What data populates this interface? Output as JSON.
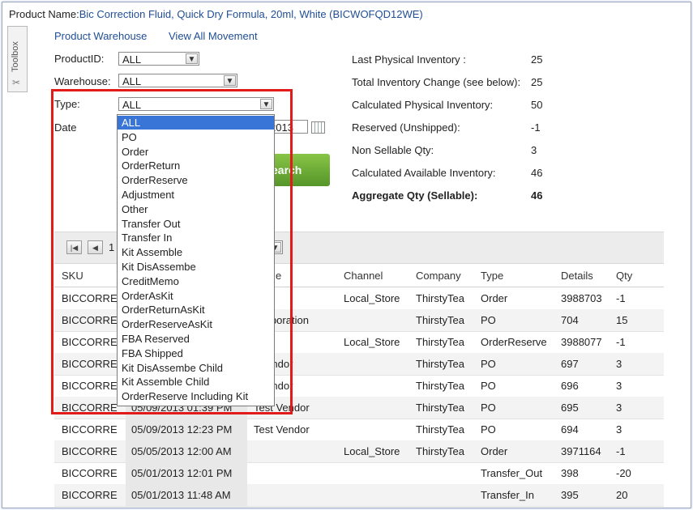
{
  "product": {
    "label": "Product Name:",
    "name": "Bic Correction Fluid, Quick Dry Formula, 20ml, White (BICWOFQD12WE)"
  },
  "toolbox": {
    "label": "Toolbox"
  },
  "links": {
    "warehouse": "Product Warehouse",
    "movement": "View All Movement"
  },
  "filters": {
    "product_id_label": "ProductID:",
    "product_id_value": "ALL",
    "warehouse_label": "Warehouse:",
    "warehouse_value": "ALL",
    "type_label": "Type:",
    "type_value": "ALL",
    "date_label": "Date",
    "date_partial": "2013"
  },
  "search_label": "earch",
  "summary": [
    {
      "label": "Last Physical Inventory :",
      "value": "25"
    },
    {
      "label": "Total Inventory Change (see below):",
      "value": "25"
    },
    {
      "label": "Calculated Physical Inventory:",
      "value": "50"
    },
    {
      "label": "Reserved (Unshipped):",
      "value": "-1"
    },
    {
      "label": "Non Sellable Qty:",
      "value": "3"
    },
    {
      "label": "Calculated Available Inventory:",
      "value": "46"
    },
    {
      "label": "Aggregate Qty (Sellable):",
      "value": "46"
    }
  ],
  "pager": {
    "page_partial": "1"
  },
  "table": {
    "headers": {
      "sku": "SKU",
      "party": "e",
      "channel": "Channel",
      "company": "Company",
      "type": "Type",
      "details": "Details",
      "qty": "Qty"
    },
    "rows": [
      {
        "sku": "BICCORRE",
        "date": "",
        "party": "",
        "channel": "Local_Store",
        "company": "ThirstyTea",
        "type": "Order",
        "details": "3988703",
        "qty": "-1"
      },
      {
        "sku": "BICCORRE",
        "date": "",
        "party": "Corporation",
        "channel": "",
        "company": "ThirstyTea",
        "type": "PO",
        "details": "704",
        "qty": "15"
      },
      {
        "sku": "BICCORRE",
        "date": "",
        "party": "",
        "channel": "Local_Store",
        "company": "ThirstyTea",
        "type": "OrderReserve",
        "details": "3988077",
        "qty": "-1"
      },
      {
        "sku": "BICCORRE",
        "date": "",
        "party": "t Vendor",
        "channel": "",
        "company": "ThirstyTea",
        "type": "PO",
        "details": "697",
        "qty": "3"
      },
      {
        "sku": "BICCORRE",
        "date": "",
        "party": "t Vendor",
        "channel": "",
        "company": "ThirstyTea",
        "type": "PO",
        "details": "696",
        "qty": "3"
      },
      {
        "sku": "BICCORRE",
        "date": "05/09/2013 01:39 PM",
        "party": "Test Vendor",
        "channel": "",
        "company": "ThirstyTea",
        "type": "PO",
        "details": "695",
        "qty": "3"
      },
      {
        "sku": "BICCORRE",
        "date": "05/09/2013 12:23 PM",
        "party": "Test Vendor",
        "channel": "",
        "company": "ThirstyTea",
        "type": "PO",
        "details": "694",
        "qty": "3"
      },
      {
        "sku": "BICCORRE",
        "date": "05/05/2013 12:00 AM",
        "party": "",
        "channel": "Local_Store",
        "company": "ThirstyTea",
        "type": "Order",
        "details": "3971164",
        "qty": "-1"
      },
      {
        "sku": "BICCORRE",
        "date": "05/01/2013 12:01 PM",
        "party": "",
        "channel": "",
        "company": "",
        "type": "Transfer_Out",
        "details": "398",
        "qty": "-20"
      },
      {
        "sku": "BICCORRE",
        "date": "05/01/2013 11:48 AM",
        "party": "",
        "channel": "",
        "company": "",
        "type": "Transfer_In",
        "details": "395",
        "qty": "20"
      }
    ]
  },
  "type_dropdown": {
    "options": [
      "ALL",
      "PO",
      "Order",
      "OrderReturn",
      "OrderReserve",
      "Adjustment",
      "Other",
      "Transfer Out",
      "Transfer In",
      "Kit Assemble",
      "Kit DisAssembe",
      "CreditMemo",
      "OrderAsKit",
      "OrderReturnAsKit",
      "OrderReserveAsKit",
      "FBA Reserved",
      "FBA Shipped",
      "Kit DisAssembe Child",
      "Kit Assemble Child",
      "OrderReserve Including Kit"
    ],
    "selected_index": 0
  },
  "colors": {
    "link": "#1f4e96",
    "highlight": "#e21a1a",
    "selected_option": "#3875d7",
    "search_button": "#6aaa35"
  }
}
